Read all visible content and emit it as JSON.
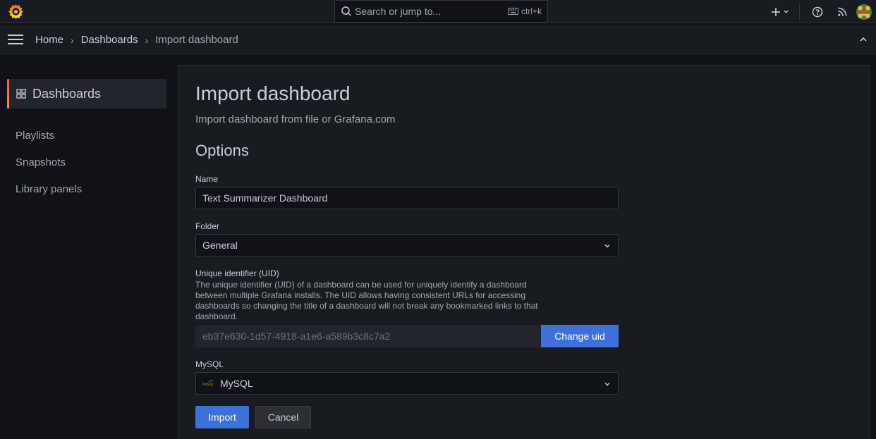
{
  "topbar": {
    "logo_icon": "grafana-logo-icon",
    "search_placeholder": "Search or jump to...",
    "search_shortcut": "ctrl+k",
    "icons": [
      "plus-icon",
      "chevron-down-icon",
      "help-icon",
      "rss-icon",
      "avatar"
    ]
  },
  "breadcrumb": {
    "items": [
      "Home",
      "Dashboards",
      "Import dashboard"
    ]
  },
  "sidebar": {
    "active_label": "Dashboards",
    "items": [
      "Playlists",
      "Snapshots",
      "Library panels"
    ]
  },
  "main": {
    "title": "Import dashboard",
    "subtitle": "Import dashboard from file or Grafana.com",
    "section_title": "Options",
    "name_label": "Name",
    "name_value": "Text Summarizer Dashboard",
    "folder_label": "Folder",
    "folder_value": "General",
    "uid_label": "Unique identifier (UID)",
    "uid_description": "The unique identifier (UID) of a dashboard can be used for uniquely identify a dashboard between multiple Grafana installs. The UID allows having consistent URLs for accessing dashboards so changing the title of a dashboard will not break any bookmarked links to that dashboard.",
    "uid_value": "eb37e630-1d57-4918-a1e6-a589b3c8c7a2",
    "change_uid_label": "Change uid",
    "datasource_label": "MySQL",
    "datasource_value": "MySQL",
    "import_label": "Import",
    "cancel_label": "Cancel"
  },
  "colors": {
    "primary": "#3d71d9",
    "accent_orange": "#f55f3e",
    "background": "#111217",
    "panel": "#181b1f"
  }
}
